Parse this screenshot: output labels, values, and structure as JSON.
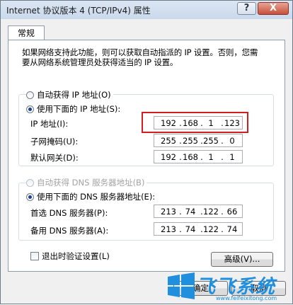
{
  "window": {
    "title": "Internet 协议版本 4 (TCP/IPv4) 属性",
    "help_label": "?",
    "close_label": "X"
  },
  "tabs": [
    {
      "label": "常规"
    }
  ],
  "description": "如果网络支持此功能，则可以获取自动指派的 IP 设置。否则，您需要从网络系统管理员处获得适当的 IP 设置。",
  "ip_section": {
    "auto_label": "自动获得 IP 地址(O)",
    "manual_label": "使用下面的 IP 地址(S):",
    "selected": "manual",
    "fields": [
      {
        "label": "IP 地址(I):",
        "octets": [
          "192",
          "168",
          "1",
          "123"
        ]
      },
      {
        "label": "子网掩码(U):",
        "octets": [
          "255",
          "255",
          "255",
          "0"
        ]
      },
      {
        "label": "默认网关(D):",
        "octets": [
          "192",
          "168",
          "1",
          "1"
        ]
      }
    ]
  },
  "dns_section": {
    "auto_label": "自动获得 DNS 服务器地址(B)",
    "manual_label": "使用下面的 DNS 服务器地址(E):",
    "selected": "manual",
    "fields": [
      {
        "label": "首选 DNS 服务器(P):",
        "octets": [
          "213",
          "74",
          "122",
          "66"
        ]
      },
      {
        "label": "备用 DNS 服务器(A):",
        "octets": [
          "213",
          "74",
          "122",
          "74"
        ]
      }
    ]
  },
  "validate_on_exit_label": "退出时验证设置(L)",
  "advanced_button": "高级(V)...",
  "ok_button": "确定",
  "cancel_button": "取消",
  "watermark": {
    "text": "飞飞系统",
    "url": "www.feifeixitong.com",
    "color": "#1f8fde"
  },
  "colors": {
    "highlight": "#d11f1f",
    "title_bar": "#c9d9ec",
    "close_button": "#c7503a"
  }
}
